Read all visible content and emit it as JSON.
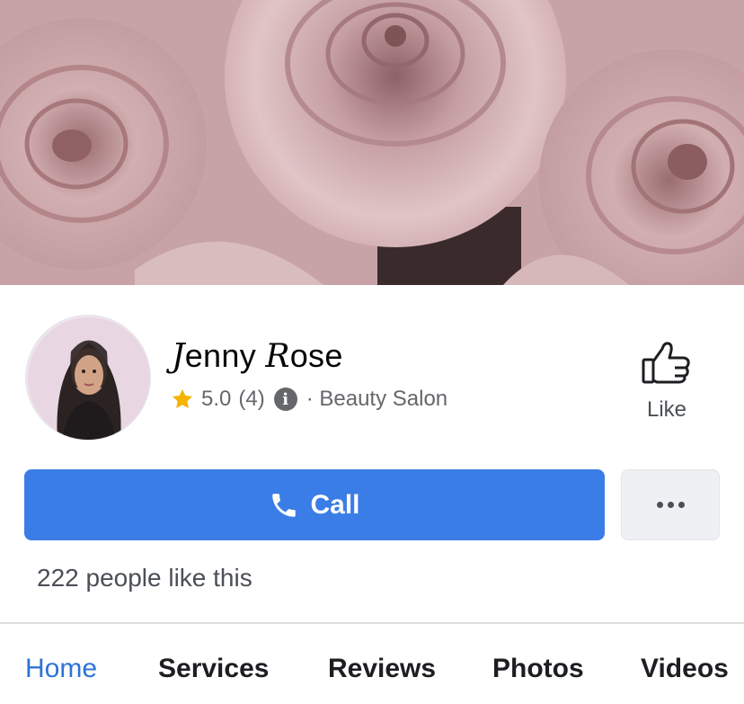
{
  "page": {
    "name_initial_1": "J",
    "name_rest_1": "enny ",
    "name_initial_2": "R",
    "name_rest_2": "ose",
    "rating": "5.0",
    "rating_count": "(4)",
    "category": "· Beauty Salon",
    "likes_text": "222 people like this"
  },
  "actions": {
    "like_label": "Like",
    "call_label": "Call"
  },
  "tabs": [
    {
      "label": "Home",
      "active": true
    },
    {
      "label": "Services",
      "active": false
    },
    {
      "label": "Reviews",
      "active": false
    },
    {
      "label": "Photos",
      "active": false
    },
    {
      "label": "Videos",
      "active": false
    }
  ],
  "colors": {
    "accent": "#3b7de6",
    "active_tab": "#2d73d8",
    "star": "#f5b400",
    "cover": "#c9a9ac"
  },
  "icons": {
    "star": "star-icon",
    "info": "info-icon",
    "like": "thumbs-up-icon",
    "call": "phone-icon",
    "more": "more-dots-icon"
  }
}
